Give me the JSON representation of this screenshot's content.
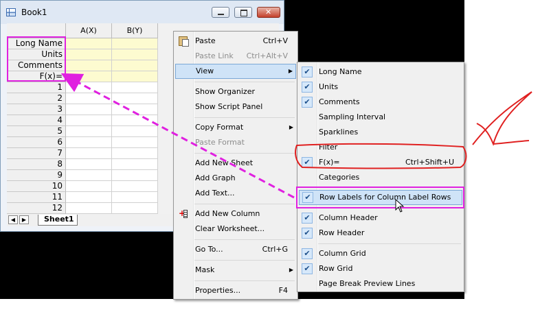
{
  "window": {
    "title": "Book1"
  },
  "worksheet": {
    "columns": [
      "A(X)",
      "B(Y)"
    ],
    "label_rows": [
      "Long Name",
      "Units",
      "Comments",
      "F(x)="
    ],
    "row_numbers": [
      "1",
      "2",
      "3",
      "4",
      "5",
      "6",
      "7",
      "8",
      "9",
      "10",
      "11",
      "12"
    ],
    "sheet_tab": "Sheet1"
  },
  "context_menu": {
    "items": [
      {
        "label": "Paste",
        "shortcut": "Ctrl+V"
      },
      {
        "label": "Paste Link",
        "shortcut": "Ctrl+Alt+V"
      },
      {
        "label": "View"
      },
      {
        "label": "Show Organizer"
      },
      {
        "label": "Show Script Panel"
      },
      {
        "label": "Copy Format"
      },
      {
        "label": "Paste Format"
      },
      {
        "label": "Add New Sheet"
      },
      {
        "label": "Add Graph"
      },
      {
        "label": "Add Text..."
      },
      {
        "label": "Add New Column"
      },
      {
        "label": "Clear Worksheet..."
      },
      {
        "label": "Go To...",
        "shortcut": "Ctrl+G"
      },
      {
        "label": "Mask"
      },
      {
        "label": "Properties...",
        "shortcut": "F4"
      }
    ]
  },
  "view_submenu": {
    "items": [
      {
        "label": "Long Name",
        "checked": true
      },
      {
        "label": "Units",
        "checked": true
      },
      {
        "label": "Comments",
        "checked": true
      },
      {
        "label": "Sampling Interval",
        "checked": false
      },
      {
        "label": "Sparklines",
        "checked": false
      },
      {
        "label": "Filter",
        "checked": false
      },
      {
        "label": "F(x)=",
        "checked": true,
        "shortcut": "Ctrl+Shift+U"
      },
      {
        "label": "Categories",
        "checked": false
      },
      {
        "label": "Row Labels for Column Label Rows",
        "checked": true
      },
      {
        "label": "Column Header",
        "checked": true
      },
      {
        "label": "Row Header",
        "checked": true
      },
      {
        "label": "Column Grid",
        "checked": true
      },
      {
        "label": "Row Grid",
        "checked": true
      },
      {
        "label": "Page Break Preview Lines",
        "checked": false
      }
    ]
  },
  "colors": {
    "highlight": "#e020e0",
    "annotation_red": "#e02020",
    "label_row_fill": "#fdfbd0",
    "menu_selection": "#cfe3f7"
  }
}
